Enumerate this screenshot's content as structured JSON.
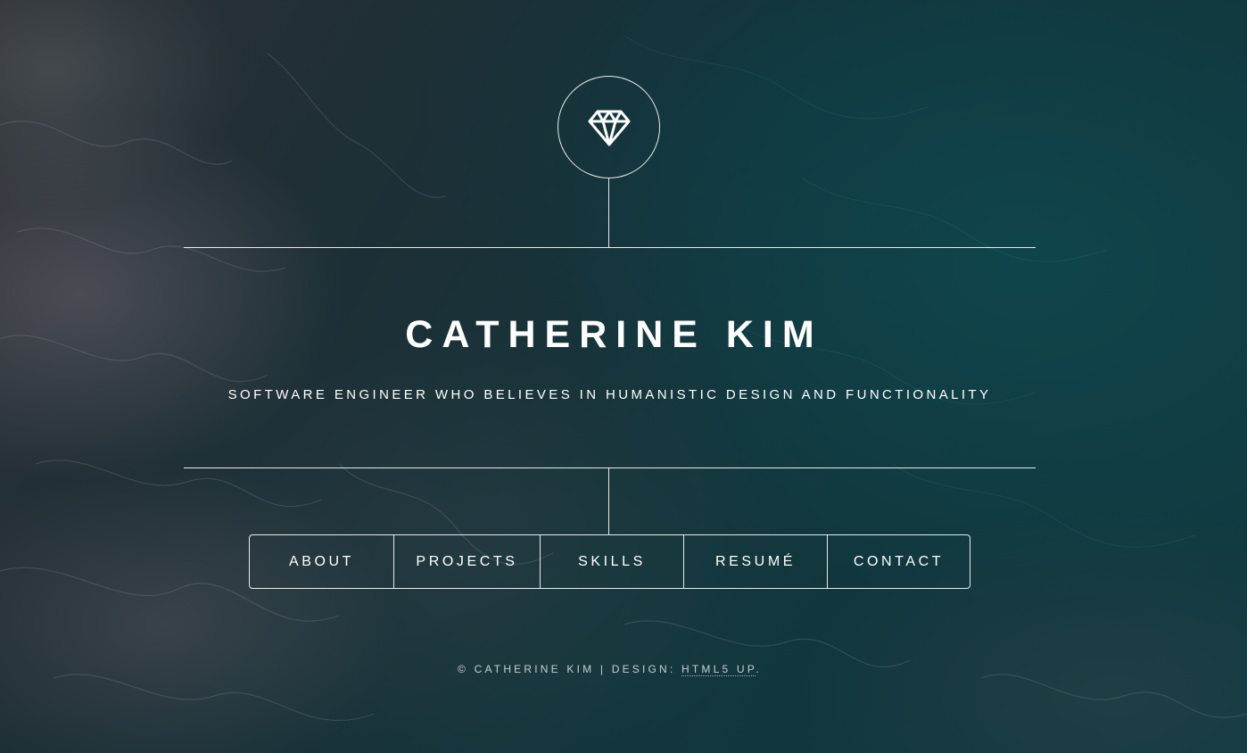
{
  "colors": {
    "text": "#ffffff",
    "background_dark": "#13252b",
    "background_teal": "#0f3a40"
  },
  "header": {
    "logo_icon": "diamond-icon",
    "title": "CATHERINE KIM",
    "subtitle": "SOFTWARE ENGINEER WHO BELIEVES IN HUMANISTIC DESIGN AND FUNCTIONALITY"
  },
  "nav": {
    "items": [
      {
        "label": "ABOUT"
      },
      {
        "label": "PROJECTS"
      },
      {
        "label": "SKILLS"
      },
      {
        "label": "RESUMÉ"
      },
      {
        "label": "CONTACT"
      }
    ]
  },
  "footer": {
    "copyright": "© CATHERINE KIM | DESIGN: ",
    "design_link": "HTML5 UP",
    "suffix": "."
  }
}
